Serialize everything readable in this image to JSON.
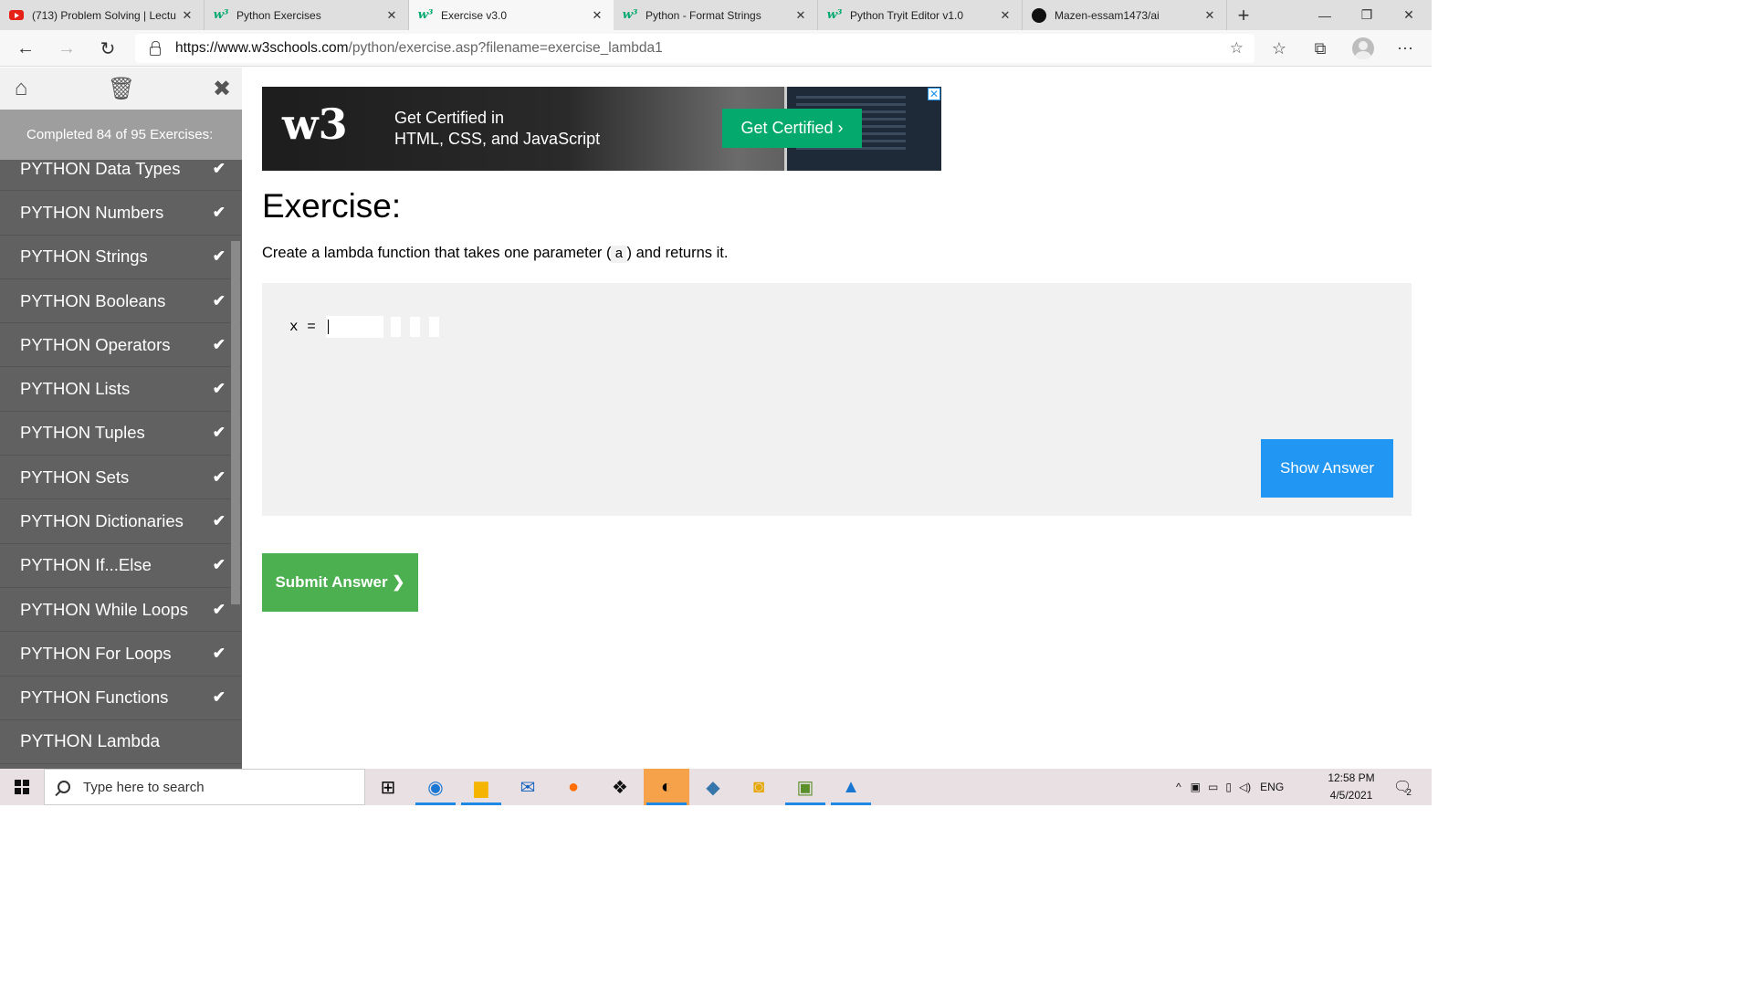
{
  "browser": {
    "tabs": [
      {
        "title": "(713) Problem Solving | Lectu",
        "icon": "youtube-icon"
      },
      {
        "title": "Python Exercises",
        "icon": "w3schools-icon"
      },
      {
        "title": "Exercise v3.0",
        "icon": "w3schools-icon",
        "active": true
      },
      {
        "title": "Python - Format Strings",
        "icon": "w3schools-icon"
      },
      {
        "title": "Python Tryit Editor v1.0",
        "icon": "w3schools-icon"
      },
      {
        "title": "Mazen-essam1473/ai",
        "icon": "github-icon"
      }
    ],
    "url_host": "https://www.w3schools.com",
    "url_path": "/python/exercise.asp?filename=exercise_lambda1"
  },
  "sidebar": {
    "progress": "Completed 84 of 95 Exercises:",
    "items": [
      {
        "label": "PYTHON Data Types",
        "done": true
      },
      {
        "label": "PYTHON Numbers",
        "done": true
      },
      {
        "label": "PYTHON Strings",
        "done": true
      },
      {
        "label": "PYTHON Booleans",
        "done": true
      },
      {
        "label": "PYTHON Operators",
        "done": true
      },
      {
        "label": "PYTHON Lists",
        "done": true
      },
      {
        "label": "PYTHON Tuples",
        "done": true
      },
      {
        "label": "PYTHON Sets",
        "done": true
      },
      {
        "label": "PYTHON Dictionaries",
        "done": true
      },
      {
        "label": "PYTHON If...Else",
        "done": true
      },
      {
        "label": "PYTHON While Loops",
        "done": true
      },
      {
        "label": "PYTHON For Loops",
        "done": true
      },
      {
        "label": "PYTHON Functions",
        "done": true
      },
      {
        "label": "PYTHON Lambda",
        "done": false
      }
    ]
  },
  "ad": {
    "logo": "w3",
    "line1": "Get Certified in",
    "line2": "HTML, CSS, and JavaScript",
    "button": "Get Certified ›"
  },
  "exercise": {
    "heading": "Exercise:",
    "desc_before": "Create a lambda function that takes one parameter (",
    "desc_code": "a",
    "desc_after": ") and returns it.",
    "code_prefix": "x =",
    "show_answer": "Show Answer",
    "submit": "Submit Answer ❯"
  },
  "taskbar": {
    "search_placeholder": "Type here to search",
    "language": "ENG",
    "time": "12:58 PM",
    "date": "4/5/2021",
    "notification_count": "2"
  }
}
